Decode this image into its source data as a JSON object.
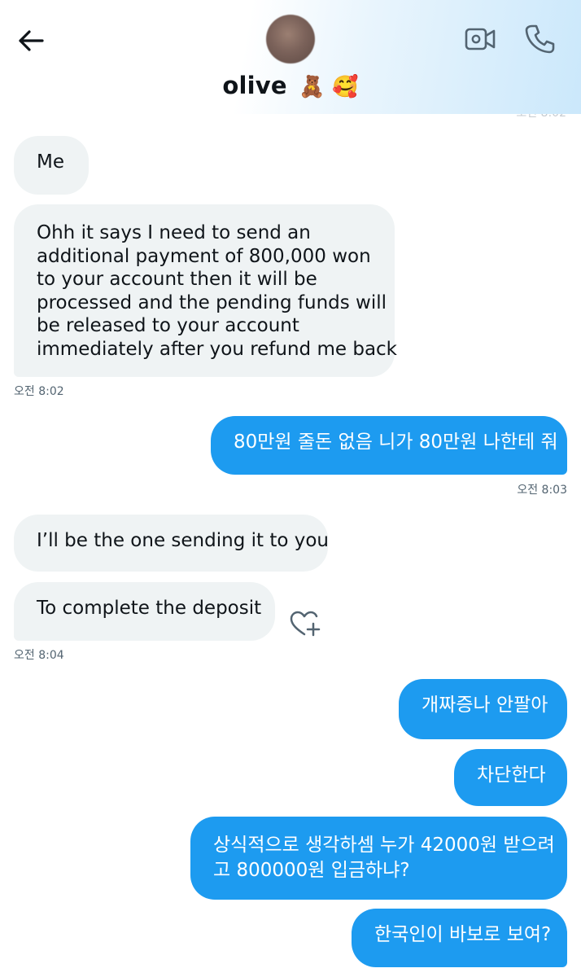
{
  "header": {
    "contact_name": "olive",
    "name_emojis": "🧸 🥰",
    "back_icon": "arrow-left-icon",
    "video_icon": "video-camera-icon",
    "call_icon": "phone-icon",
    "partial_timestamp": "오전 8:02"
  },
  "messages": [
    {
      "text": "Me"
    },
    {
      "lines": [
        "Ohh it says I need to send an",
        "additional payment of 800,000 won",
        "to your account then it will be",
        "processed and the pending funds will",
        "be released to your account",
        "immediately after you refund me back"
      ],
      "timestamp": "오전 8:02"
    },
    {
      "text": "80만원 줄돈 없음 니가 80만원 나한테 줘",
      "timestamp": "오전 8:03"
    },
    {
      "text": "I’ll be the one sending it to you"
    },
    {
      "text": "To complete the deposit",
      "timestamp": "오전 8:04"
    },
    {
      "text": "개짜증나 안팔아"
    },
    {
      "text": "차단한다"
    },
    {
      "lines": [
        "상식적으로 생각하셈 누가 42000원 받으려",
        "고 800000원 입금하냐?"
      ]
    },
    {
      "text": "한국인이 바보로 보여?"
    }
  ],
  "colors": {
    "accent": "#1d9bf0",
    "incoming_bubble": "#eff3f4",
    "text": "#0f1419",
    "timestamp": "#536471",
    "icon": "#536471"
  }
}
